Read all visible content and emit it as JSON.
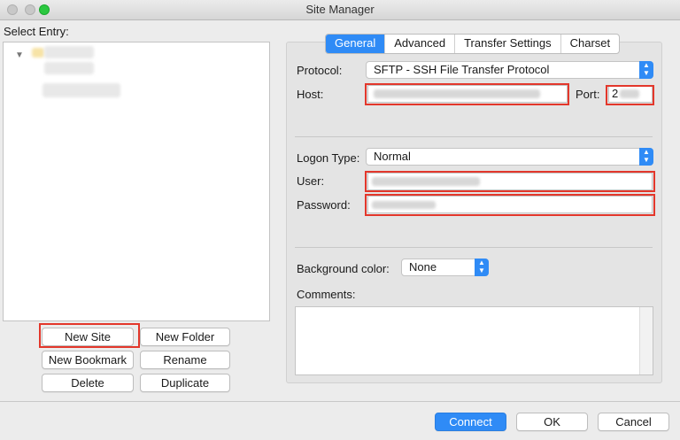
{
  "window": {
    "title": "Site Manager"
  },
  "left": {
    "select_entry_label": "Select Entry:",
    "buttons": {
      "new_site": "New Site",
      "new_folder": "New Folder",
      "new_bookmark": "New Bookmark",
      "rename": "Rename",
      "delete": "Delete",
      "duplicate": "Duplicate"
    }
  },
  "tabs": [
    "General",
    "Advanced",
    "Transfer Settings",
    "Charset"
  ],
  "general": {
    "protocol_label": "Protocol:",
    "protocol_value": "SFTP - SSH File Transfer Protocol",
    "host_label": "Host:",
    "port_label": "Port:",
    "port_value": "2",
    "logon_type_label": "Logon Type:",
    "logon_type_value": "Normal",
    "user_label": "User:",
    "password_label": "Password:",
    "background_color_label": "Background color:",
    "background_color_value": "None",
    "comments_label": "Comments:"
  },
  "footer": {
    "connect": "Connect",
    "ok": "OK",
    "cancel": "Cancel"
  },
  "colors": {
    "accent": "#2f8bf6",
    "highlight": "#e3372b"
  }
}
